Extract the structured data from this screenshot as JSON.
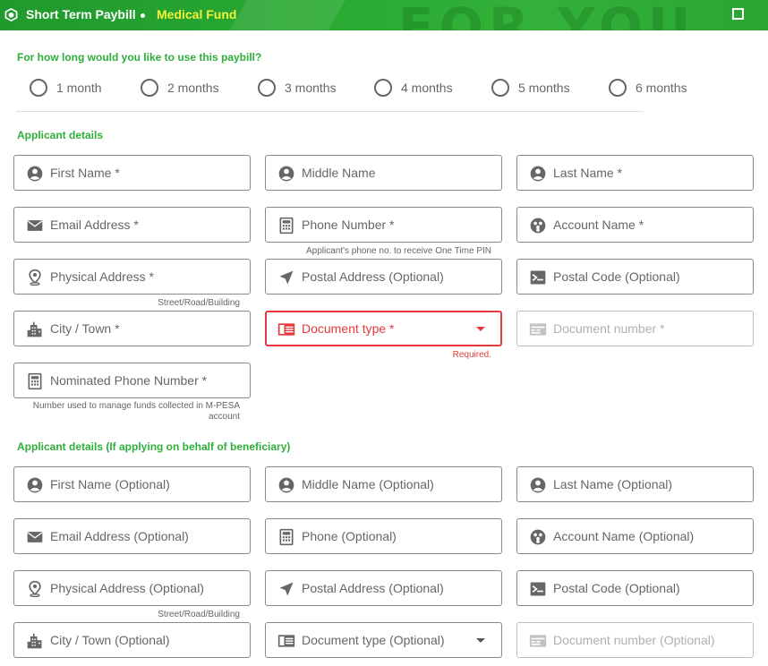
{
  "header": {
    "app_title": "Short Term Paybill",
    "subtitle": "Medical Fund",
    "watermark": "FOR YOU",
    "colors": {
      "bar": "#2aaa33",
      "subtitle": "#f2f23a"
    },
    "icons": [
      "paybill-logo-icon",
      "maximize-icon"
    ]
  },
  "duration": {
    "question": "For how long would you like to use this paybill?",
    "options": [
      "1 month",
      "2 months",
      "3 months",
      "4 months",
      "5 months",
      "6 months"
    ]
  },
  "applicant": {
    "title": "Applicant details",
    "first_name": "First Name *",
    "middle_name": "Middle Name",
    "last_name": "Last Name *",
    "email": "Email Address *",
    "phone": "Phone Number *",
    "phone_helper": "Applicant's phone no. to receive One Time PIN",
    "account_name": "Account Name *",
    "physical_address": "Physical Address *",
    "physical_helper": "Street/Road/Building",
    "postal_address": "Postal Address (Optional)",
    "postal_code": "Postal Code (Optional)",
    "city": "City / Town *",
    "document_type": "Document type *",
    "document_type_error": "Required.",
    "document_number": "Document number *",
    "nominated_phone": "Nominated Phone Number *",
    "nominated_helper": "Number used to manage funds collected in M-PESA account"
  },
  "beneficiary": {
    "title": "Applicant details (If applying on behalf of beneficiary)",
    "first_name": "First Name (Optional)",
    "middle_name": "Middle Name (Optional)",
    "last_name": "Last Name (Optional)",
    "email": "Email Address (Optional)",
    "phone": "Phone (Optional)",
    "account_name": "Account Name (Optional)",
    "physical_address": "Physical Address (Optional)",
    "physical_helper": "Street/Road/Building",
    "postal_address": "Postal Address (Optional)",
    "postal_code": "Postal Code (Optional)",
    "city": "City / Town (Optional)",
    "document_type": "Document type (Optional)",
    "document_number": "Document number (Optional)"
  },
  "colors": {
    "accent": "#2eaf3a",
    "error": "#e5393b",
    "border": "#8a8a8a",
    "disabled": "#b0b0b0"
  }
}
